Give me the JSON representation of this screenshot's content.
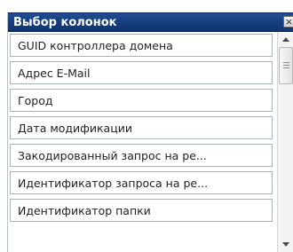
{
  "window": {
    "title": "Выбор колонок",
    "close_glyph": "×"
  },
  "columns": [
    {
      "label": "GUID контроллера домена"
    },
    {
      "label": "Адрес E-Mail"
    },
    {
      "label": "Город"
    },
    {
      "label": "Дата модификации"
    },
    {
      "label": "Закодированный запрос на ре..."
    },
    {
      "label": "Идентификатор запроса на ре..."
    },
    {
      "label": "Идентификатор папки"
    }
  ],
  "scrollbar": {
    "up_icon": "triangle-up",
    "down_icon": "triangle-down",
    "position": 0
  },
  "colors": {
    "title_bar": "#163e7e",
    "title_text": "#ffffff",
    "item_border": "#a9b1b9"
  }
}
